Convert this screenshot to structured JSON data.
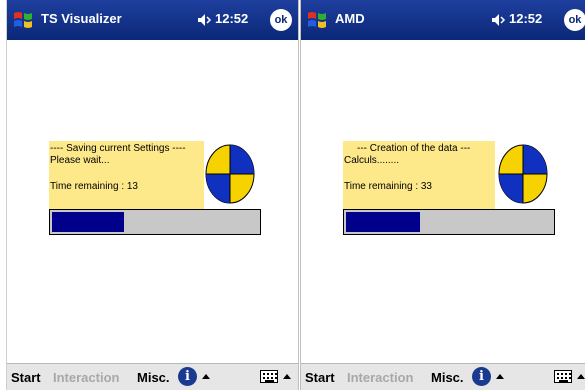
{
  "screens": [
    {
      "title": "TS Visualizer",
      "time": "12:52",
      "ok_label": "ok",
      "dialog_line1": "---- Saving current Settings ----",
      "dialog_line2": "Please wait...",
      "dialog_line3": "Time remaining : 13",
      "progress_fraction": 0.35,
      "menu": {
        "start": "Start",
        "interaction": "Interaction",
        "misc": "Misc."
      }
    },
    {
      "title": "AMD",
      "time": "12:52",
      "ok_label": "ok",
      "dialog_line1": "--- Creation of the data ---",
      "dialog_line2": "Calculs........",
      "dialog_line3": "Time remaining : 33",
      "progress_fraction": 0.36,
      "menu": {
        "start": "Start",
        "interaction": "Interaction",
        "misc": "Misc."
      }
    }
  ],
  "icons": {
    "start": "windows-flag-icon",
    "volume": "speaker-icon",
    "ok": "ok-button",
    "busy": "pie-clock-icon",
    "help": "info-icon",
    "sip": "keyboard-icon",
    "arrow": "up-arrow-icon"
  },
  "colors": {
    "titlebar": "#0b2777",
    "dialog_bg": "#fde98a",
    "progress_fill": "#00008b",
    "progress_track": "#c8c8c8",
    "pie_blue": "#1030c0",
    "pie_yellow": "#f5d200"
  }
}
